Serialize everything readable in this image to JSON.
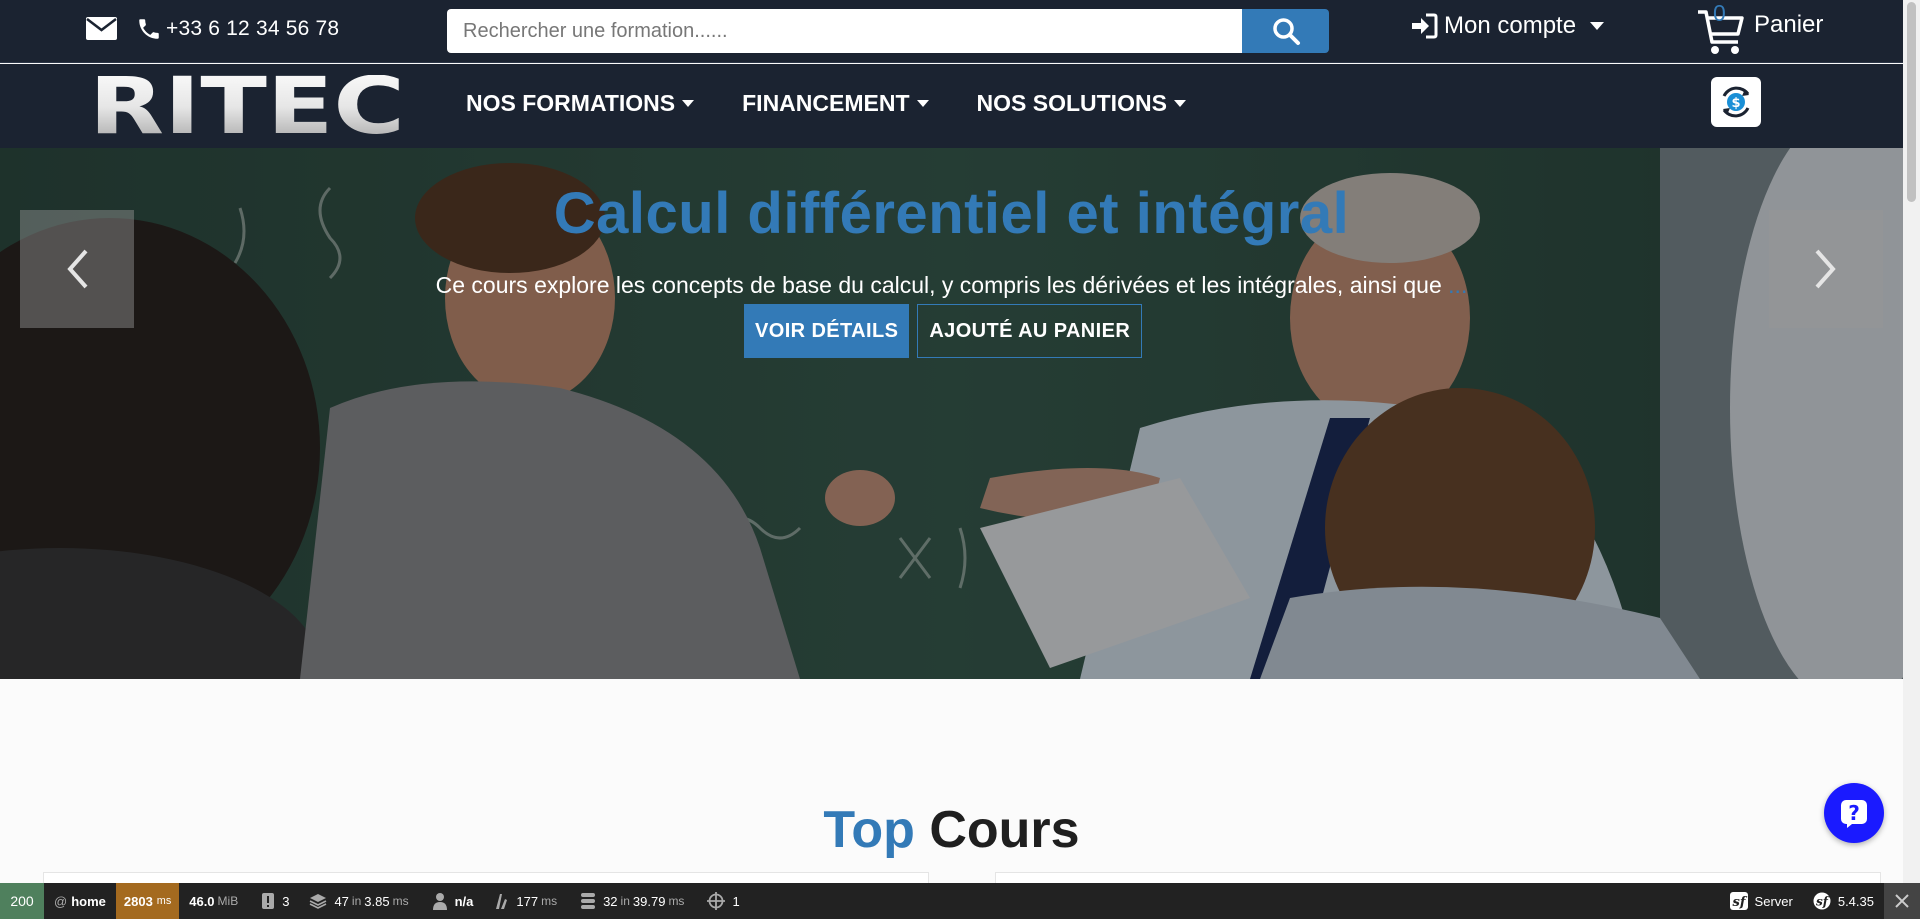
{
  "topbar": {
    "phone": "+33 6 12 34 56 78",
    "search_placeholder": "Rechercher une formation......",
    "account_label": "Mon compte",
    "cart_count": "0",
    "cart_label": "Panier"
  },
  "logo_text": "RITEC",
  "nav": {
    "items": [
      {
        "label": "NOS FORMATIONS"
      },
      {
        "label": "FINANCEMENT"
      },
      {
        "label": "NOS SOLUTIONS"
      }
    ]
  },
  "hero": {
    "title": "Calcul différentiel et intégral",
    "text": "Ce cours explore les concepts de base du calcul, y compris les dérivées et les intégrales, ainsi que",
    "ellipsis": "...",
    "details_label": "VOIR DÉTAILS",
    "cart_label": "AJOUTÉ AU PANIER"
  },
  "section": {
    "title_accent": "Top",
    "title_rest": "Cours"
  },
  "debug": {
    "status": "200",
    "route_prefix": "@",
    "route": "home",
    "time": "2803",
    "time_unit": "ms",
    "memory": "46.0",
    "memory_unit": "MiB",
    "logs": "3",
    "templates": "47",
    "templates_in": "in",
    "templates_time": "3.85",
    "templates_unit": "ms",
    "user": "n/a",
    "render_time": "177",
    "render_unit": "ms",
    "queries": "32",
    "queries_in": "in",
    "queries_time": "39.79",
    "queries_unit": "ms",
    "forms": "1",
    "server_label": "Server",
    "version": "5.4.35"
  },
  "colors": {
    "navy": "#1b2331",
    "accent": "#337ab7",
    "help": "#1a1aff",
    "debug_ok": "#4f805d",
    "debug_time": "#a46a1f"
  }
}
